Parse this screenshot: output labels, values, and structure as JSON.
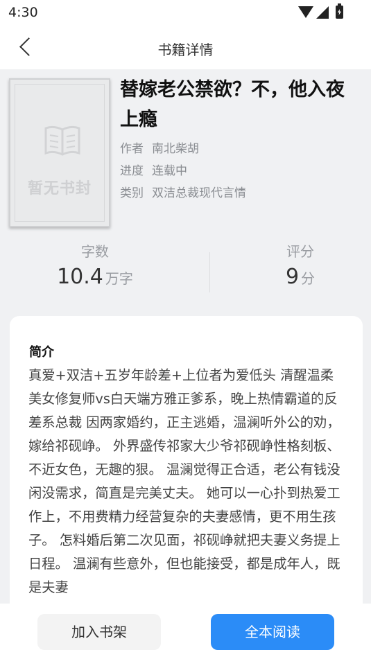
{
  "status_bar": {
    "time": "4:30"
  },
  "header": {
    "title": "书籍详情"
  },
  "book": {
    "cover_text": "暂无书封",
    "title": "替嫁老公禁欲？不，他入夜上瘾",
    "author_label": "作者",
    "author": "南北柴胡",
    "progress_label": "进度",
    "progress": "连载中",
    "category_label": "类别",
    "category": "双洁总裁现代言情"
  },
  "stats": {
    "words_label": "字数",
    "words_value": "10.4",
    "words_unit": "万字",
    "rating_label": "评分",
    "rating_value": "9",
    "rating_unit": "分"
  },
  "intro": {
    "title": "简介",
    "text": "真爱+双洁+五岁年龄差+上位者为爱低头 清醒温柔美女修复师vs白天端方雅正爹系，晚上热情霸道的反差系总裁 因两家婚约，正主逃婚，温澜听外公的劝，嫁给祁砚峥。 外界盛传祁家大少爷祁砚峥性格刻板、不近女色，无趣的狠。 温澜觉得正合适，老公有钱没闲没需求，简直是完美丈夫。 她可以一心扑到热爱工作上，不用费精力经营复杂的夫妻感情，更不用生孩子。 怎料婚后第二次见面，祁砚峥就把夫妻义务提上日程。 温澜有些意外，但也能接受，都是成年人，既是夫妻"
  },
  "actions": {
    "add_shelf": "加入书架",
    "read_all": "全本阅读"
  },
  "colors": {
    "accent": "#2b8cf7",
    "background": "#f0f1f3"
  }
}
